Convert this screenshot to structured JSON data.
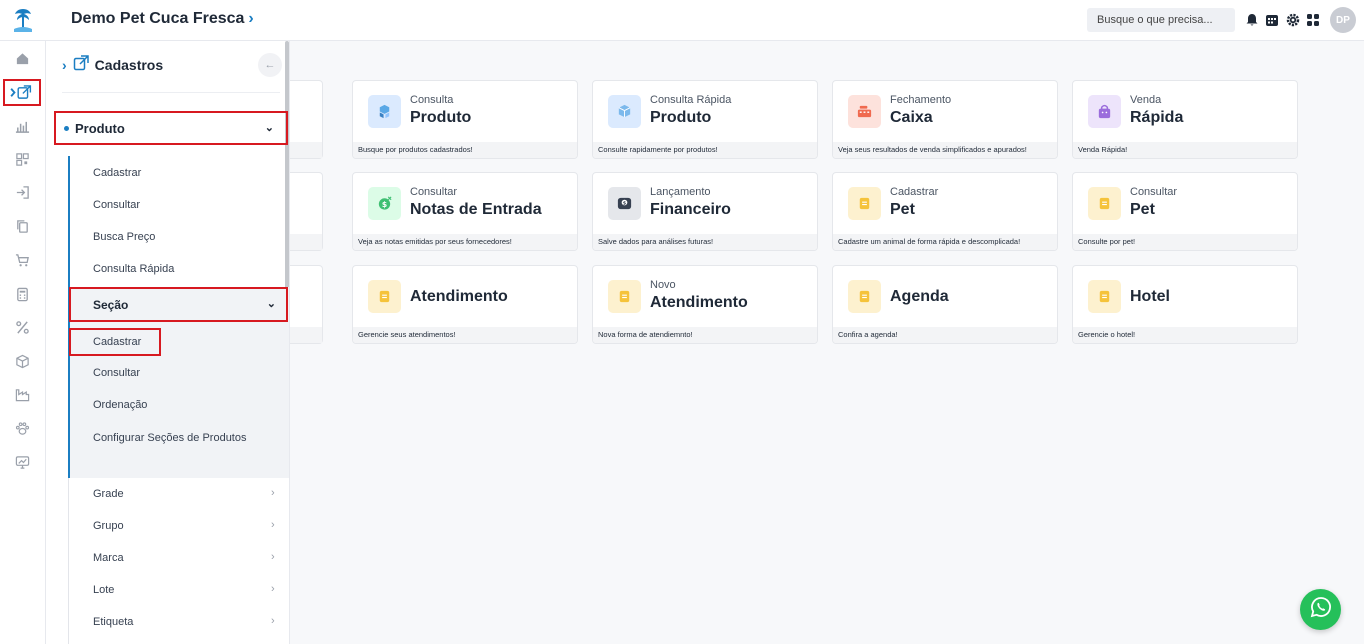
{
  "header": {
    "company": "Demo Pet Cuca Fresca",
    "search_placeholder": "Busque o que precisa...",
    "avatar": "DP",
    "icons": [
      "notification-icon",
      "calendar-icon",
      "settings-icon",
      "apps-grid-icon"
    ]
  },
  "rail": {
    "items": [
      "home-icon",
      "cadastros-icon",
      "chart-icon",
      "qr-icon",
      "login-icon",
      "copy-icon",
      "cart-icon",
      "calculator-icon",
      "percent-icon",
      "box-icon",
      "factory-icon",
      "paw-icon",
      "monitor-chart-icon"
    ]
  },
  "menu": {
    "title": "Cadastros",
    "section": "Produto",
    "items": [
      {
        "label": "Cadastrar"
      },
      {
        "label": "Consultar"
      },
      {
        "label": "Busca Preço"
      },
      {
        "label": "Consulta Rápida"
      }
    ],
    "secao": {
      "label": "Seção",
      "items": [
        {
          "label": "Cadastrar"
        },
        {
          "label": "Consultar"
        },
        {
          "label": "Ordenação"
        },
        {
          "label": "Configurar Seções de Produtos"
        }
      ]
    },
    "groups": [
      {
        "label": "Grade"
      },
      {
        "label": "Grupo"
      },
      {
        "label": "Marca"
      },
      {
        "label": "Lote"
      },
      {
        "label": "Etiqueta"
      }
    ]
  },
  "cards": [
    {
      "subtitle": "Consulta",
      "title": "Produto",
      "footer": "Busque por produtos cadastrados!",
      "icon": "cubes-icon",
      "color": "#dbeafe"
    },
    {
      "subtitle": "Consulta Rápida",
      "title": "Produto",
      "footer": "Consulte rapidamente por produtos!",
      "icon": "box-icon",
      "color": "#dbeafe"
    },
    {
      "subtitle": "Fechamento",
      "title": "Caixa",
      "footer": "Veja seus resultados de venda simplificados e apurados!",
      "icon": "cash-register-icon",
      "color": "#fde2dc"
    },
    {
      "subtitle": "Venda",
      "title": "Rápida",
      "footer": "Venda Rápida!",
      "icon": "shopping-bag-icon",
      "color": "#ede4fb"
    },
    {
      "subtitle": "Consultar",
      "title": "Notas de Entrada",
      "footer": "Veja as notas emitidas por seus fornecedores!",
      "icon": "money-icon",
      "color": "#dcfce7"
    },
    {
      "subtitle": "Lançamento",
      "title": "Financeiro",
      "footer": "Salve dados para análises futuras!",
      "icon": "wallet-icon",
      "color": "#e5e7eb"
    },
    {
      "subtitle": "Cadastrar",
      "title": "Pet",
      "footer": "Cadastre um animal de forma rápida e descomplicada!",
      "icon": "note-icon",
      "color": "#fdf1cf"
    },
    {
      "subtitle": "Consultar",
      "title": "Pet",
      "footer": "Consulte por pet!",
      "icon": "note-icon",
      "color": "#fdf1cf"
    },
    {
      "subtitle": "",
      "title": "Atendimento",
      "footer": "Gerencie seus atendimentos!",
      "icon": "note-icon",
      "color": "#fdf1cf"
    },
    {
      "subtitle": "Novo",
      "title": "Atendimento",
      "footer": "Nova forma de atendiemnto!",
      "icon": "note-icon",
      "color": "#fdf1cf"
    },
    {
      "subtitle": "",
      "title": "Agenda",
      "footer": "Confira a agenda!",
      "icon": "note-icon",
      "color": "#fdf1cf"
    },
    {
      "subtitle": "",
      "title": "Hotel",
      "footer": "Gerencie o hotel!",
      "icon": "note-icon",
      "color": "#fdf1cf"
    }
  ],
  "colors": {
    "accent": "#1b7ec2",
    "highlight": "#d71920",
    "whatsapp": "#25c05a"
  }
}
